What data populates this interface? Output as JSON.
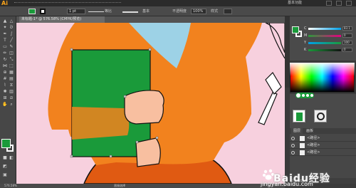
{
  "app": {
    "logo": "Ai",
    "workspace": "基本功能"
  },
  "control_bar": {
    "stroke_value": "1 pt",
    "profile_label": "等比",
    "brush_label": "基本",
    "opacity_label": "不透明度",
    "opacity_value": "100%",
    "style_label": "样式"
  },
  "document": {
    "tab_label": "未标题-1* @ 576.58% (CMYK/预览)",
    "zoom": "576.58%",
    "status": "直接选择"
  },
  "color_panel": {
    "sliders": [
      {
        "label": "C",
        "value": "83.1",
        "color": "#00a0e9"
      },
      {
        "label": "M",
        "value": "0",
        "color": "#e4007f"
      },
      {
        "label": "Y",
        "value": "100",
        "color": "#fff100"
      },
      {
        "label": "K",
        "value": "0",
        "color": "#111111"
      }
    ],
    "fill_color": "#1a9a3a"
  },
  "layers_panel": {
    "tabs": [
      "图层",
      "画板"
    ],
    "rows": [
      {
        "name": "<路径>"
      },
      {
        "name": "<路径>"
      },
      {
        "name": "<路径>"
      }
    ],
    "footer": "1 个图层"
  },
  "watermark": {
    "text": "Baidu经验",
    "url": "jingyan.baidu.com"
  },
  "colors": {
    "canvas_bg": "#f7d0de",
    "shirt": "#f2821e",
    "book": "#1a9a3a",
    "skin": "#f8bfa0",
    "collar": "#9dd2e6",
    "pants": "#e05a12"
  }
}
